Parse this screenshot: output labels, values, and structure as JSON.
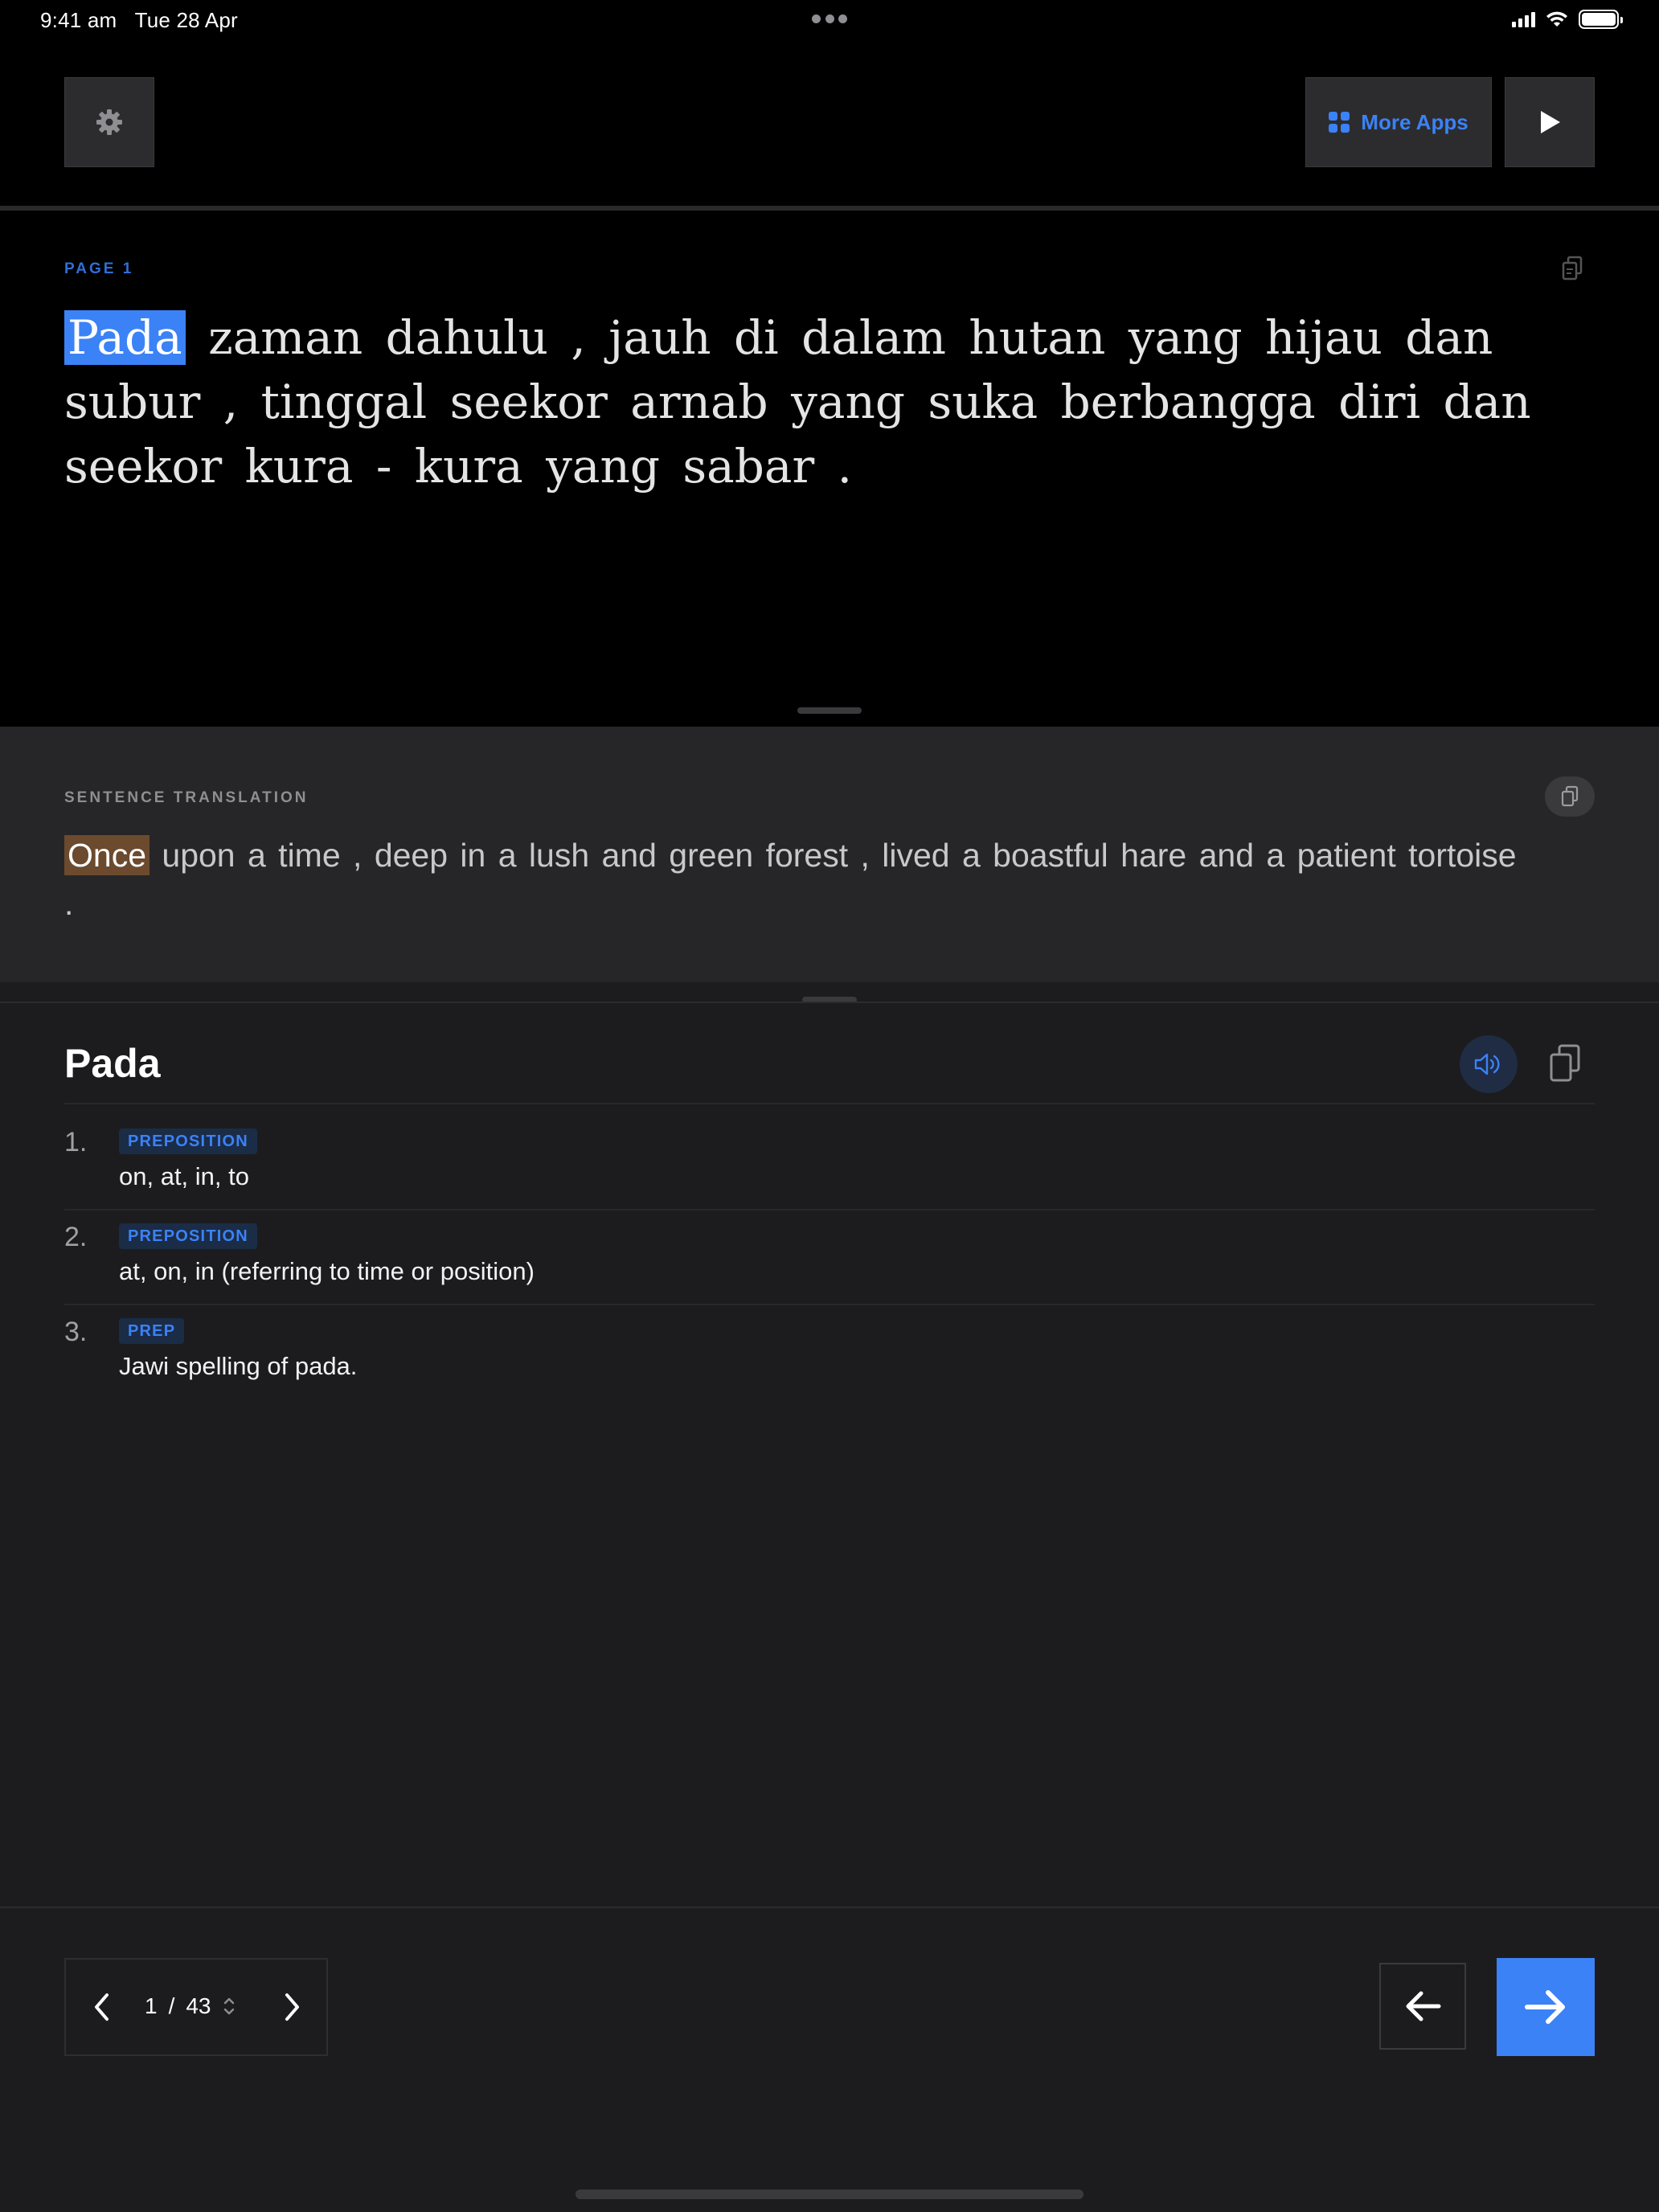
{
  "status_bar": {
    "time": "9:41 am",
    "date": "Tue 28 Apr"
  },
  "toolbar": {
    "more_apps_label": "More Apps",
    "accent_color": "#3b82f6"
  },
  "reader": {
    "page_label": "PAGE 1",
    "highlighted_word": "Pada",
    "text_rest": " zaman dahulu , jauh di dalam hutan yang hijau dan subur , tinggal seekor arnab yang suka berbangga diri dan seekor kura - kura yang sabar ."
  },
  "translation": {
    "label": "SENTENCE TRANSLATION",
    "highlighted_word": "Once",
    "text_rest": " upon a time , deep in a lush and green forest , lived a boastful hare and a patient tortoise ."
  },
  "dictionary": {
    "word": "Pada",
    "definitions": [
      {
        "number": "1.",
        "pos": "PREPOSITION",
        "text": "on, at, in, to"
      },
      {
        "number": "2.",
        "pos": "PREPOSITION",
        "text": "at, on, in (referring to time or position)"
      },
      {
        "number": "3.",
        "pos": "PREP",
        "text": "Jawi spelling of pada."
      }
    ]
  },
  "pagination": {
    "current": "1",
    "separator": "/",
    "total": "43"
  }
}
